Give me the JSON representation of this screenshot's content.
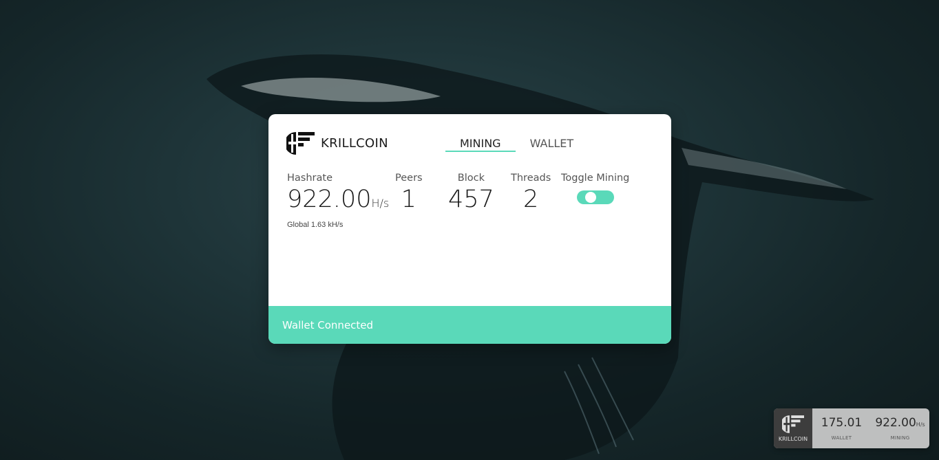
{
  "colors": {
    "accent": "#5ad9b9",
    "card_bg": "#ffffff",
    "status_text": "#ffffff",
    "mini_logo_bg": "#3d3d3d"
  },
  "brand": {
    "name": "KRILLCOIN",
    "icon": "krillcoin-logo-icon"
  },
  "tabs": [
    {
      "label": "MINING",
      "active": true
    },
    {
      "label": "WALLET",
      "active": false
    }
  ],
  "stats": {
    "hashrate": {
      "label": "Hashrate",
      "value": "922.00",
      "unit": "H/s",
      "global": "Global 1.63 kH/s"
    },
    "peers": {
      "label": "Peers",
      "value": "1"
    },
    "block": {
      "label": "Block",
      "value": "457"
    },
    "threads": {
      "label": "Threads",
      "value": "2"
    },
    "toggle_mining": {
      "label": "Toggle Mining",
      "enabled": true
    }
  },
  "status": {
    "text": "Wallet Connected"
  },
  "mini_widget": {
    "brand": "KRILLCOIN",
    "wallet": {
      "value": "175.01",
      "label": "WALLET"
    },
    "mining": {
      "value": "922.00",
      "unit": "H/s",
      "label": "MINING"
    }
  }
}
